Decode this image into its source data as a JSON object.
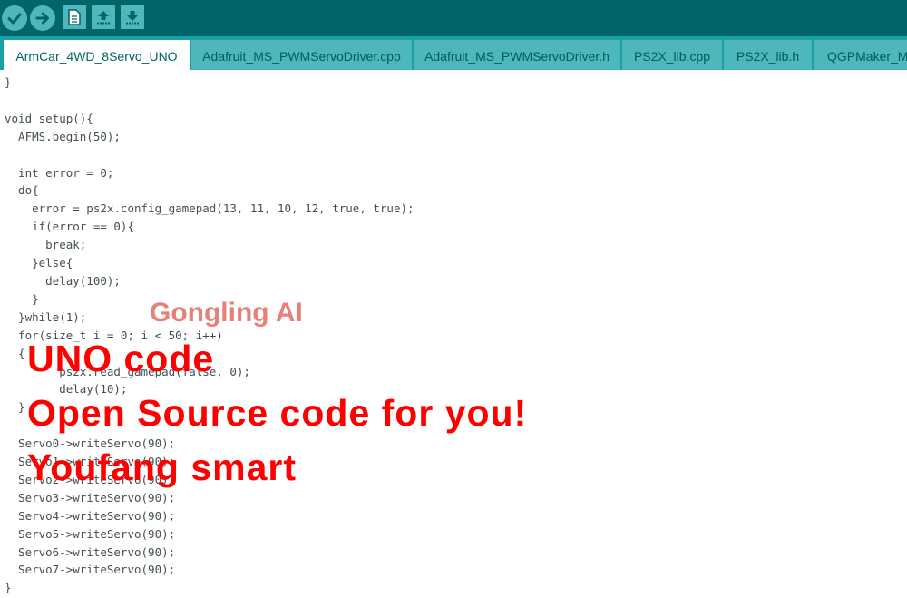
{
  "toolbar": {
    "buttons": [
      {
        "icon": "checkmark-icon"
      },
      {
        "icon": "arrow-right-icon"
      },
      {
        "icon": "new-file-icon"
      },
      {
        "icon": "open-upload-icon"
      },
      {
        "icon": "save-download-icon"
      }
    ],
    "colors": {
      "bar": "#006468",
      "button": "#4db7bb"
    }
  },
  "tabs": [
    {
      "label": "ArmCar_4WD_8Servo_UNO",
      "active": true
    },
    {
      "label": "Adafruit_MS_PWMServoDriver.cpp",
      "active": false
    },
    {
      "label": "Adafruit_MS_PWMServoDriver.h",
      "active": false
    },
    {
      "label": "PS2X_lib.cpp",
      "active": false
    },
    {
      "label": "PS2X_lib.h",
      "active": false
    },
    {
      "label": "QGPMaker_M",
      "active": false
    }
  ],
  "editor": {
    "lines": [
      "}",
      "",
      "void setup(){",
      "  AFMS.begin(50);",
      "",
      "  int error = 0;",
      "  do{",
      "    error = ps2x.config_gamepad(13, 11, 10, 12, true, true);",
      "    if(error == 0){",
      "      break;",
      "    }else{",
      "      delay(100);",
      "    }",
      "  }while(1);",
      "  for(size_t i = 0; i < 50; i++)",
      "  {",
      "        ps2x.read_gamepad(false, 0);",
      "        delay(10);",
      "  }",
      "",
      "  Servo0->writeServo(90);",
      "  Servo1->writeServo(90);",
      "  Servo2->writeServo(90);",
      "  Servo3->writeServo(90);",
      "  Servo4->writeServo(90);",
      "  Servo5->writeServo(90);",
      "  Servo6->writeServo(90);",
      "  Servo7->writeServo(90);",
      "}"
    ]
  },
  "watermark": {
    "brand": "Gongling AI",
    "line1": "UNO code",
    "line2": "Open Source code for you!",
    "line3": "Youfang smart",
    "colors": {
      "brand": "#e8807a",
      "main": "#ff0000"
    }
  }
}
